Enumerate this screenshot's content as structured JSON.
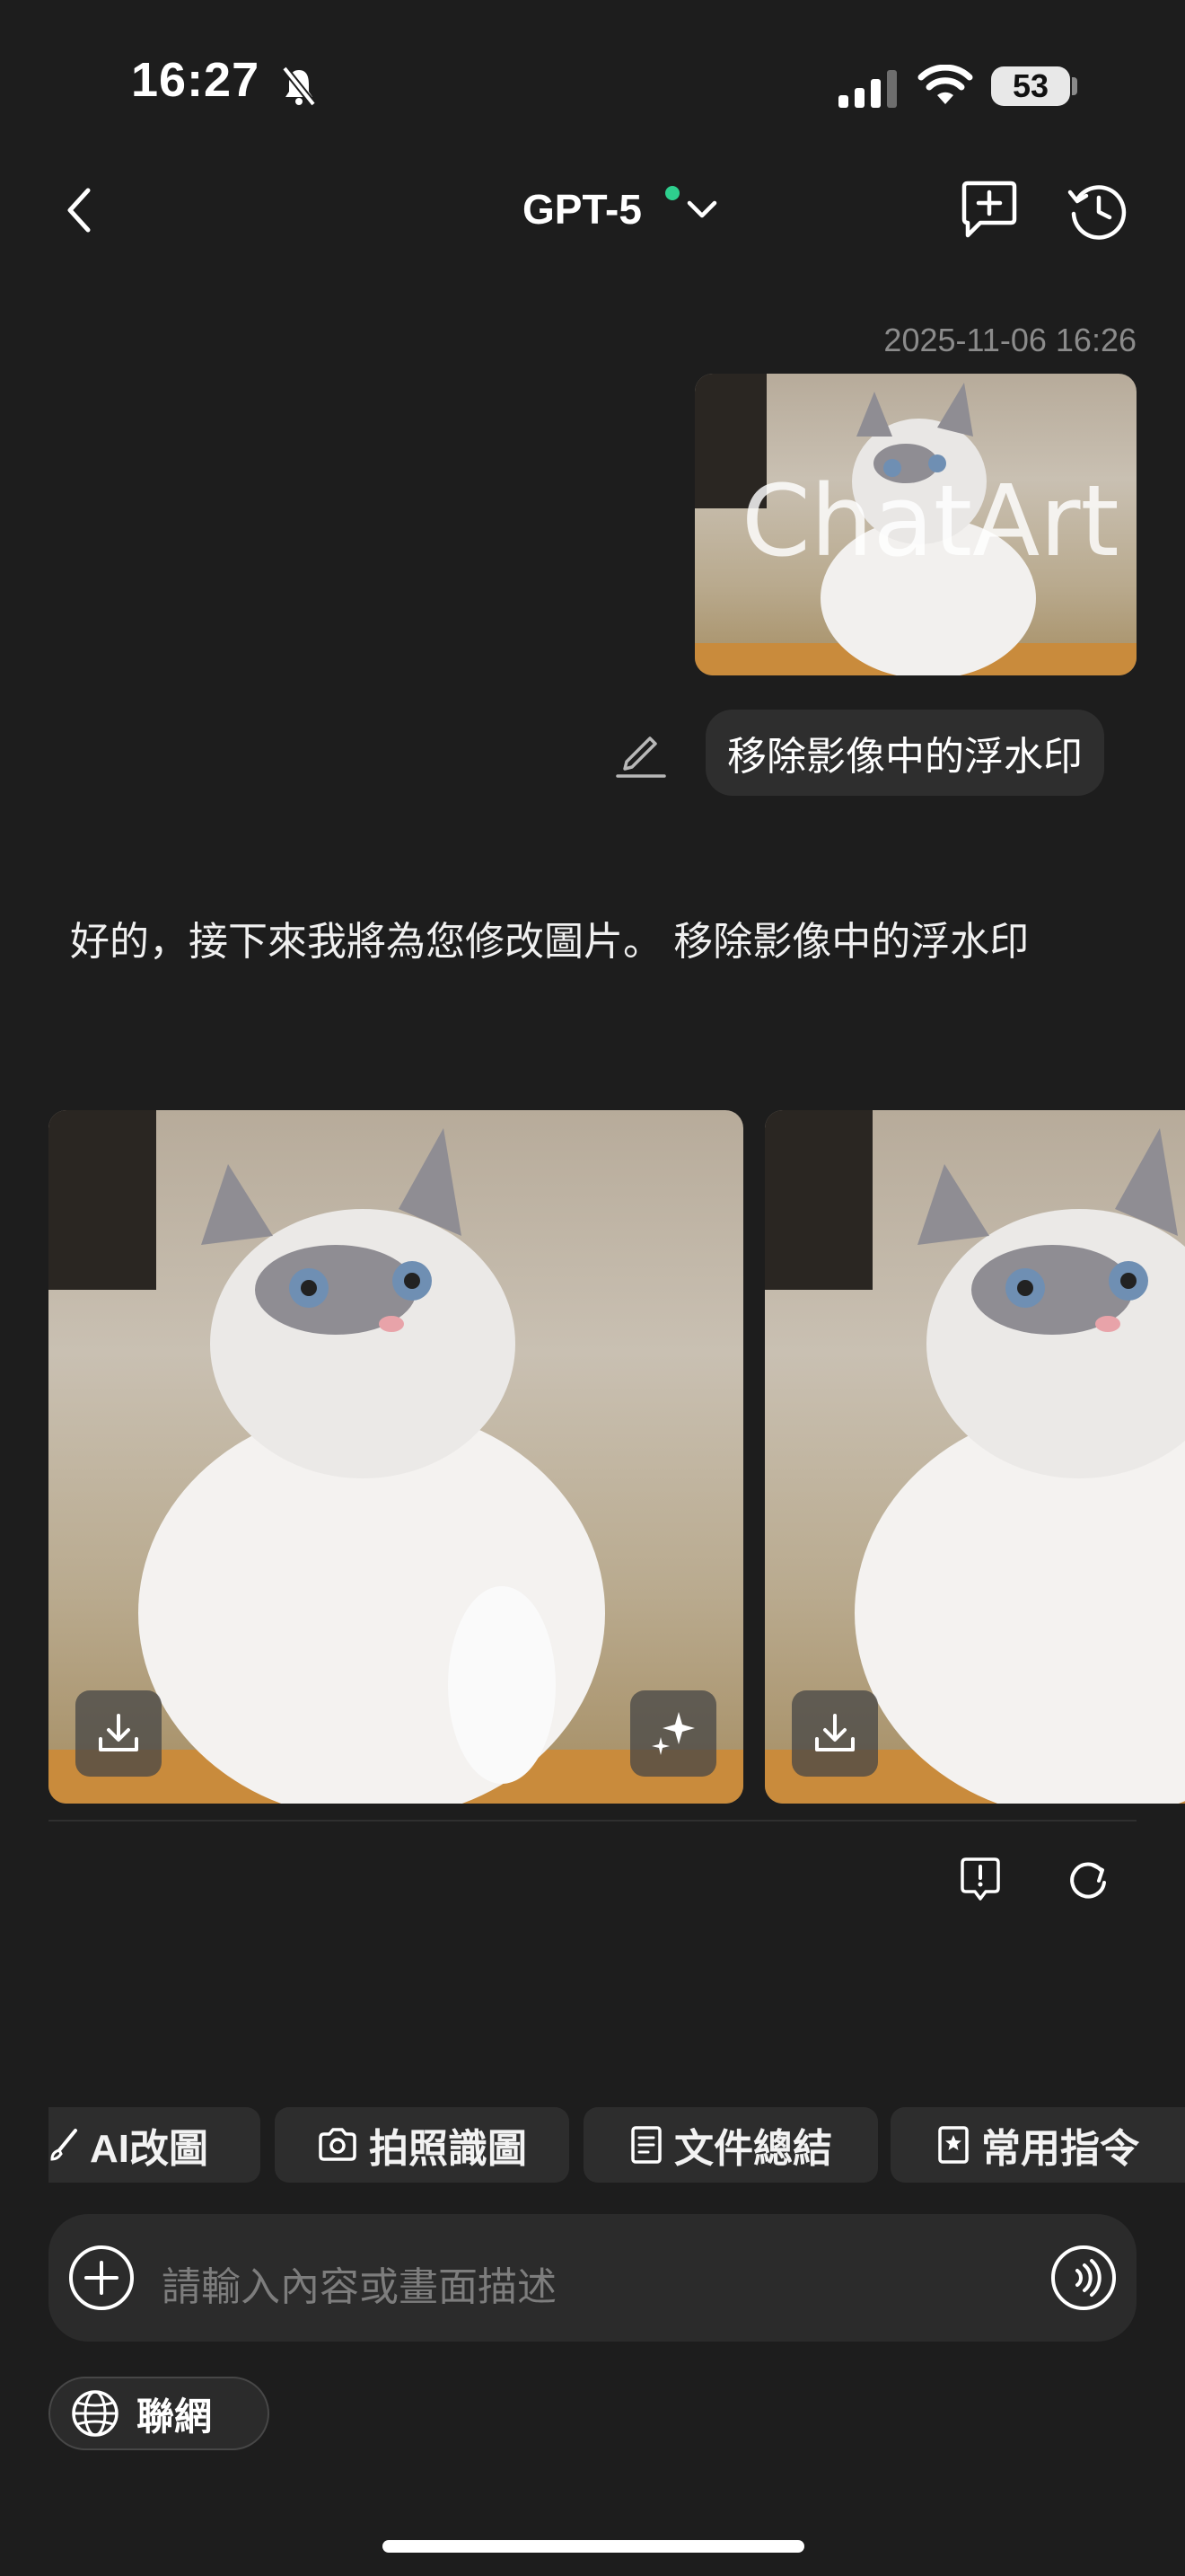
{
  "status_bar": {
    "time": "16:27",
    "battery": "53"
  },
  "header": {
    "title": "GPT-5",
    "icons": [
      "back-icon",
      "chevron-down-icon",
      "new-chat-icon",
      "history-icon"
    ]
  },
  "chat": {
    "timestamp": "2025-11-06 16:26",
    "uploaded_image_watermark": "ChatArt",
    "user_message": "移除影像中的浮水印",
    "assistant_reply": "好的，接下來我將為您修改圖片。 移除影像中的浮水印"
  },
  "quick_actions": [
    {
      "label": "AI改圖",
      "icon": "brush-icon"
    },
    {
      "label": "拍照識圖",
      "icon": "camera-icon"
    },
    {
      "label": "文件總結",
      "icon": "document-icon"
    },
    {
      "label": "常用指令",
      "icon": "star-note-icon"
    }
  ],
  "composer": {
    "placeholder": "請輸入內容或畫面描述"
  },
  "network_button": {
    "label": "聯網",
    "icon": "globe-icon"
  },
  "colors": {
    "background": "#1d1d1d",
    "bubble": "#2e2e2e",
    "online_dot": "#2ecf8e"
  }
}
